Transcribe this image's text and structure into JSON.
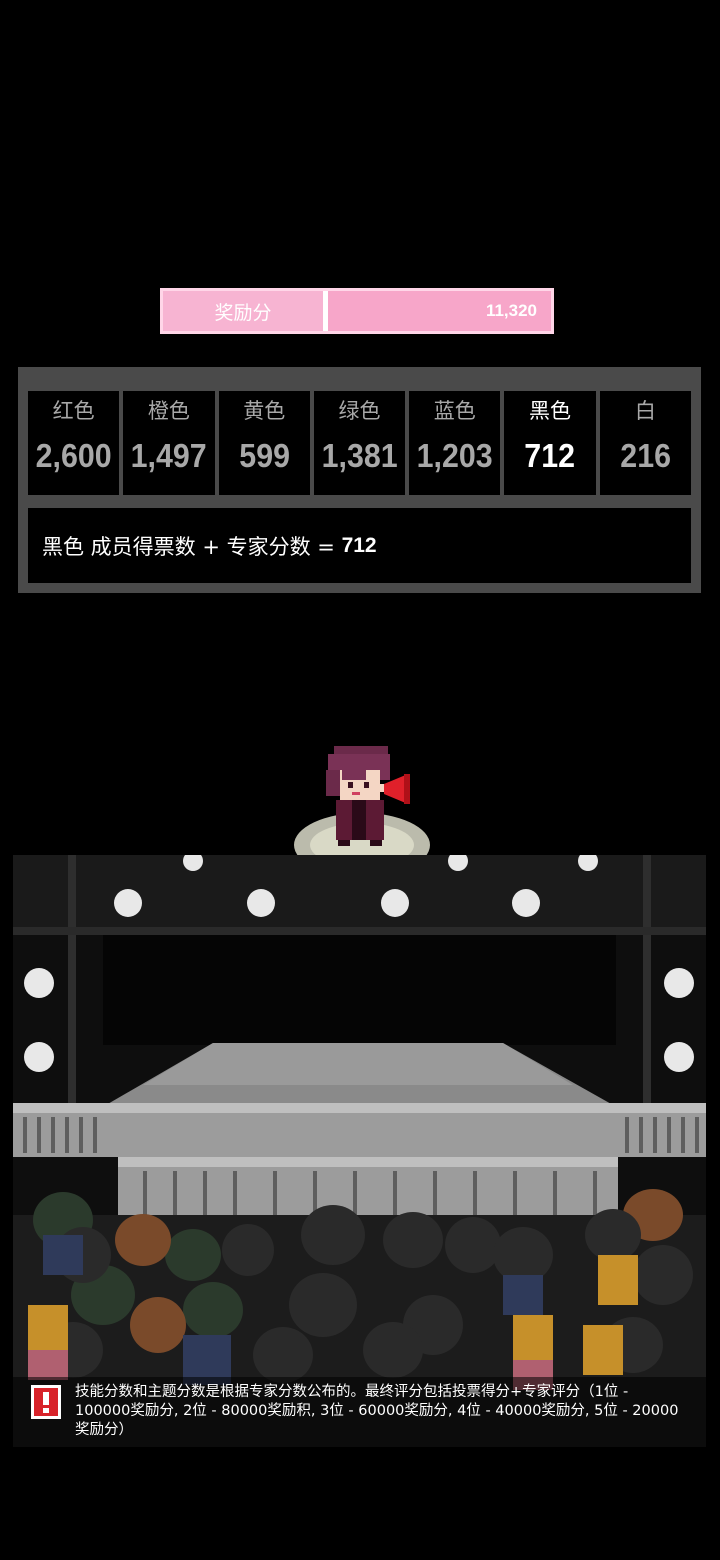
{
  "bonus": {
    "label": "奖励分",
    "value": "11,320"
  },
  "teams": [
    {
      "name": "红色",
      "score": "2,600"
    },
    {
      "name": "橙色",
      "score": "1,497"
    },
    {
      "name": "黄色",
      "score": "599"
    },
    {
      "name": "绿色",
      "score": "1,381"
    },
    {
      "name": "蓝色",
      "score": "1,203"
    },
    {
      "name": "黑色",
      "score": "712",
      "active": true
    },
    {
      "name": "白",
      "score": "216"
    }
  ],
  "formula": {
    "text": "黑色 成员得票数 + 专家分数 = ",
    "value": "712"
  },
  "notice": {
    "icon": "info-exclamation-icon",
    "text": "技能分数和主题分数是根据专家分数公布的。最终评分包括投票得分+专家评分（1位 - 100000奖励分, 2位 - 80000奖励积, 3位 - 60000奖励分, 4位 - 40000奖励分, 5位 - 20000奖励分）"
  }
}
